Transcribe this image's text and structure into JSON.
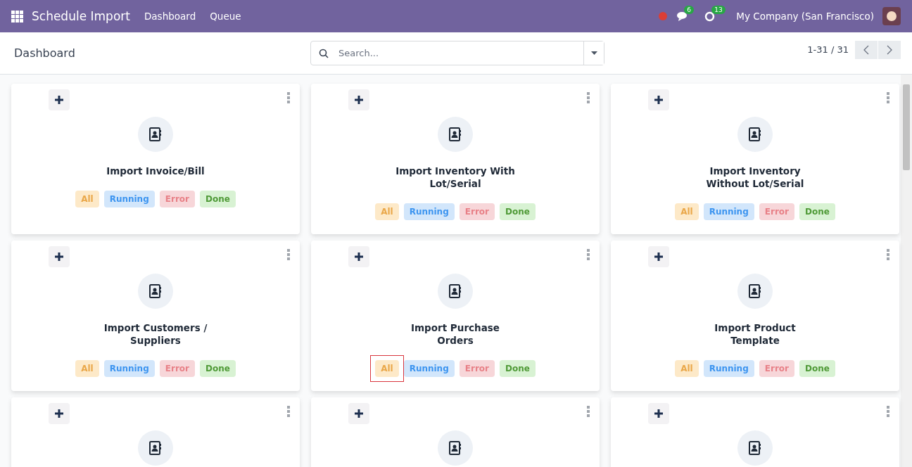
{
  "navbar": {
    "app_name": "Schedule Import",
    "menu": [
      "Dashboard",
      "Queue"
    ],
    "messages_count": "6",
    "activities_count": "13",
    "company": "My Company (San Francisco)"
  },
  "control_panel": {
    "breadcrumb": "Dashboard",
    "search": {
      "placeholder": "Search..."
    },
    "pager": "1-31 / 31"
  },
  "cards": [
    {
      "title": "Import Invoice/Bill",
      "filters": [
        {
          "kind": "all",
          "label": "All",
          "outlined": false
        },
        {
          "kind": "running",
          "label": "Running",
          "outlined": false
        },
        {
          "kind": "error",
          "label": "Error",
          "outlined": false
        },
        {
          "kind": "done",
          "label": "Done",
          "outlined": false
        }
      ]
    },
    {
      "title": "Import Inventory With Lot/Serial",
      "filters": [
        {
          "kind": "all",
          "label": "All",
          "outlined": false
        },
        {
          "kind": "running",
          "label": "Running",
          "outlined": false
        },
        {
          "kind": "error",
          "label": "Error",
          "outlined": false
        },
        {
          "kind": "done",
          "label": "Done",
          "outlined": false
        }
      ]
    },
    {
      "title": "Import Inventory Without Lot/Serial",
      "filters": [
        {
          "kind": "all",
          "label": "All",
          "outlined": false
        },
        {
          "kind": "running",
          "label": "Running",
          "outlined": false
        },
        {
          "kind": "error",
          "label": "Error",
          "outlined": false
        },
        {
          "kind": "done",
          "label": "Done",
          "outlined": false
        }
      ]
    },
    {
      "title": "Import Customers / Suppliers",
      "filters": [
        {
          "kind": "all",
          "label": "All",
          "outlined": false
        },
        {
          "kind": "running",
          "label": "Running",
          "outlined": false
        },
        {
          "kind": "error",
          "label": "Error",
          "outlined": false
        },
        {
          "kind": "done",
          "label": "Done",
          "outlined": false
        }
      ]
    },
    {
      "title": "Import Purchase Orders",
      "filters": [
        {
          "kind": "all",
          "label": "All",
          "outlined": true
        },
        {
          "kind": "running",
          "label": "Running",
          "outlined": false
        },
        {
          "kind": "error",
          "label": "Error",
          "outlined": false
        },
        {
          "kind": "done",
          "label": "Done",
          "outlined": false
        }
      ]
    },
    {
      "title": "Import Product Template",
      "filters": [
        {
          "kind": "all",
          "label": "All",
          "outlined": false
        },
        {
          "kind": "running",
          "label": "Running",
          "outlined": false
        },
        {
          "kind": "error",
          "label": "Error",
          "outlined": false
        },
        {
          "kind": "done",
          "label": "Done",
          "outlined": false
        }
      ]
    },
    {
      "kind": "cut_off"
    },
    {
      "kind": "cut_off"
    },
    {
      "kind": "cut_off"
    }
  ]
}
